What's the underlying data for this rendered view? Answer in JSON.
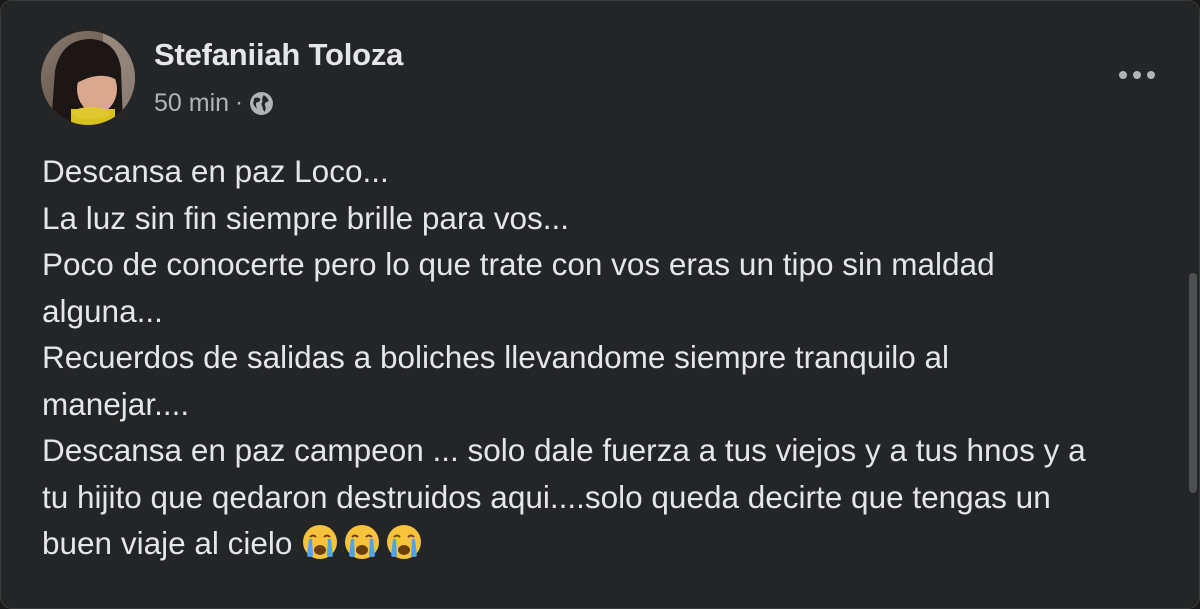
{
  "post": {
    "author": "Stefaniiah Toloza",
    "timestamp": "50 min",
    "separator": "·",
    "privacy_icon": "globe-icon",
    "more_icon": "more-options-icon",
    "lines": [
      "Descansa en paz Loco...",
      "La luz sin fin siempre brille para vos...",
      "Poco de conocerte pero lo que trate con vos eras un tipo sin maldad",
      "alguna...",
      "Recuerdos de salidas a boliches llevandome siempre tranquilo al",
      "manejar....",
      "Descansa en paz campeon ... solo dale fuerza a tus viejos y a tus hnos y a",
      "tu hijito que qedaron destruidos aqui....solo queda decirte que tengas un",
      "buen viaje al cielo"
    ],
    "emojis": [
      "crying-face-emoji",
      "crying-face-emoji",
      "crying-face-emoji"
    ]
  },
  "colors": {
    "card_background": "#242526",
    "primary_text": "#e4e6eb",
    "secondary_text": "#b0b3b8",
    "emoji_yellow": "#f7c33c",
    "emoji_tear": "#4fa3e8"
  }
}
